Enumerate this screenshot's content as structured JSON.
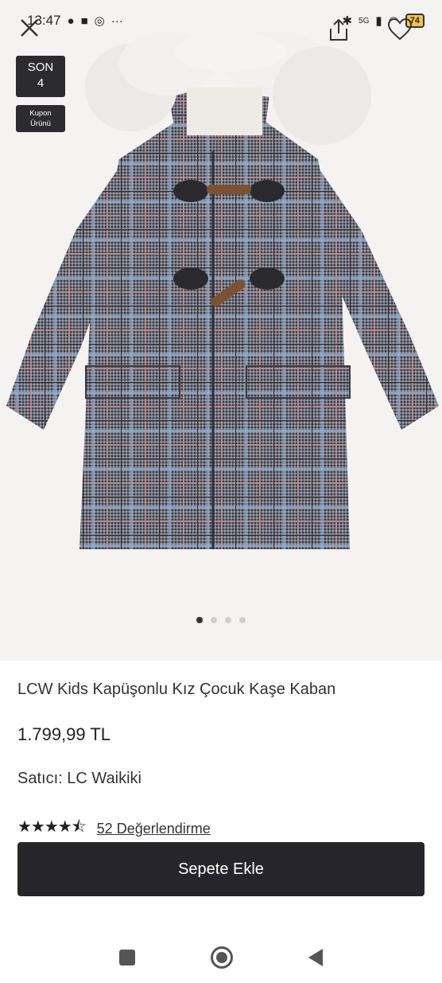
{
  "status_bar": {
    "time": "13:47",
    "battery": "74",
    "network": "5G"
  },
  "badges": {
    "son_line1": "SON",
    "son_line2": "4",
    "kupon_line1": "Kupon",
    "kupon_line2": "Ürünü"
  },
  "gallery": {
    "image_count": 4,
    "active_index": 0
  },
  "product": {
    "title": "LCW Kids Kapüşonlu Kız Çocuk Kaşe Kaban",
    "price": "1.799,99 TL",
    "seller_label": "Satıcı:",
    "seller_name": "LC Waikiki",
    "rating": 4.5,
    "stars": "★★★★⯪",
    "reviews": "52 Değerlendirme"
  },
  "actions": {
    "add_to_cart": "Sepete Ekle"
  },
  "icons": {
    "close": "close-icon",
    "share": "share-icon",
    "favorite": "heart-icon"
  },
  "colors": {
    "button_bg": "#25252b",
    "badge_bg": "#2b2b30"
  }
}
